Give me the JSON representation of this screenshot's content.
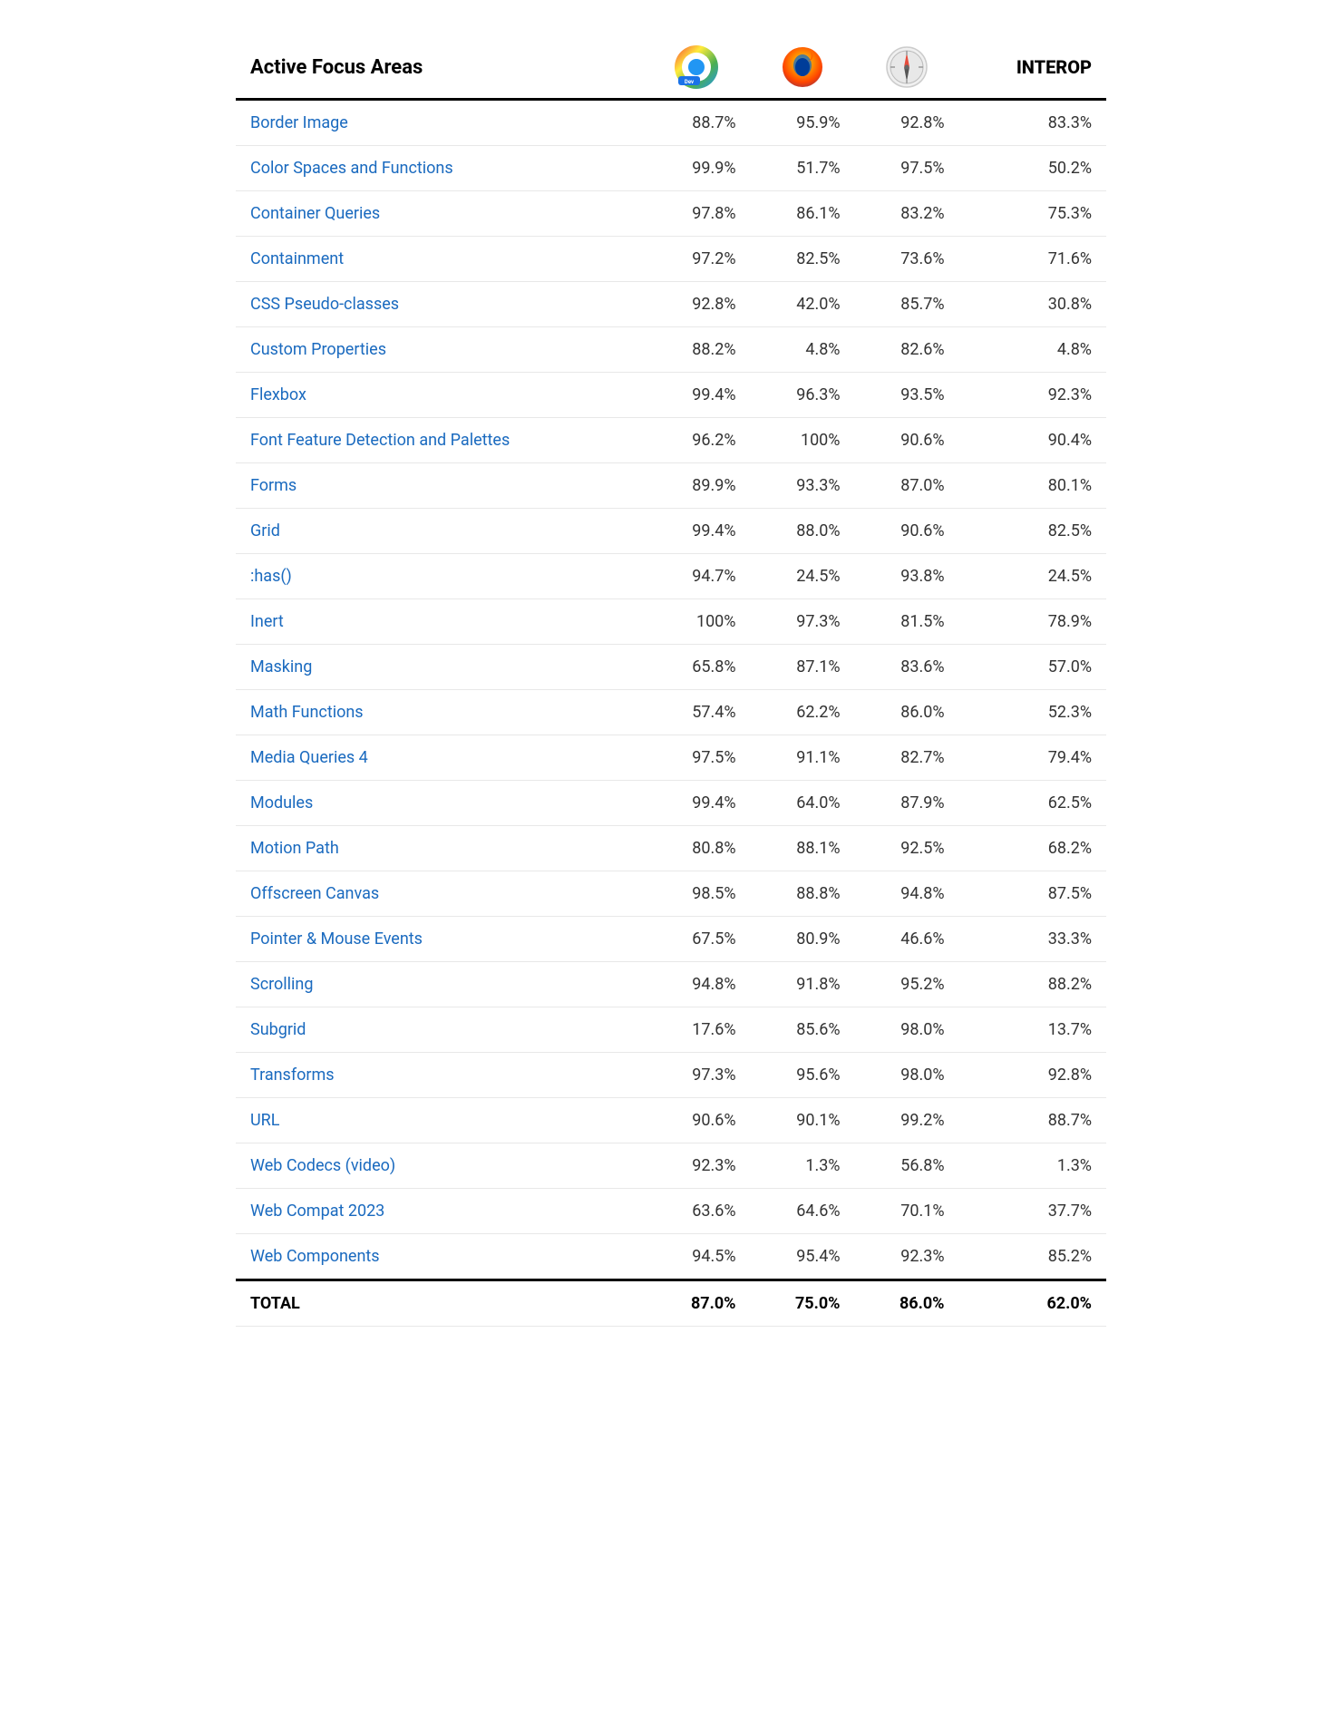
{
  "header": {
    "col1": "Active Focus Areas",
    "col4": "INTEROP",
    "icons": {
      "chrome": "Chrome Dev",
      "firefox": "Firefox",
      "safari": "Safari"
    }
  },
  "rows": [
    {
      "name": "Border Image",
      "chrome": "88.7%",
      "firefox": "95.9%",
      "safari": "92.8%",
      "interop": "83.3%"
    },
    {
      "name": "Color Spaces and Functions",
      "chrome": "99.9%",
      "firefox": "51.7%",
      "safari": "97.5%",
      "interop": "50.2%"
    },
    {
      "name": "Container Queries",
      "chrome": "97.8%",
      "firefox": "86.1%",
      "safari": "83.2%",
      "interop": "75.3%"
    },
    {
      "name": "Containment",
      "chrome": "97.2%",
      "firefox": "82.5%",
      "safari": "73.6%",
      "interop": "71.6%"
    },
    {
      "name": "CSS Pseudo-classes",
      "chrome": "92.8%",
      "firefox": "42.0%",
      "safari": "85.7%",
      "interop": "30.8%"
    },
    {
      "name": "Custom Properties",
      "chrome": "88.2%",
      "firefox": "4.8%",
      "safari": "82.6%",
      "interop": "4.8%"
    },
    {
      "name": "Flexbox",
      "chrome": "99.4%",
      "firefox": "96.3%",
      "safari": "93.5%",
      "interop": "92.3%"
    },
    {
      "name": "Font Feature Detection and Palettes",
      "chrome": "96.2%",
      "firefox": "100%",
      "safari": "90.6%",
      "interop": "90.4%"
    },
    {
      "name": "Forms",
      "chrome": "89.9%",
      "firefox": "93.3%",
      "safari": "87.0%",
      "interop": "80.1%"
    },
    {
      "name": "Grid",
      "chrome": "99.4%",
      "firefox": "88.0%",
      "safari": "90.6%",
      "interop": "82.5%"
    },
    {
      "name": ":has()",
      "chrome": "94.7%",
      "firefox": "24.5%",
      "safari": "93.8%",
      "interop": "24.5%"
    },
    {
      "name": "Inert",
      "chrome": "100%",
      "firefox": "97.3%",
      "safari": "81.5%",
      "interop": "78.9%"
    },
    {
      "name": "Masking",
      "chrome": "65.8%",
      "firefox": "87.1%",
      "safari": "83.6%",
      "interop": "57.0%"
    },
    {
      "name": "Math Functions",
      "chrome": "57.4%",
      "firefox": "62.2%",
      "safari": "86.0%",
      "interop": "52.3%"
    },
    {
      "name": "Media Queries 4",
      "chrome": "97.5%",
      "firefox": "91.1%",
      "safari": "82.7%",
      "interop": "79.4%"
    },
    {
      "name": "Modules",
      "chrome": "99.4%",
      "firefox": "64.0%",
      "safari": "87.9%",
      "interop": "62.5%"
    },
    {
      "name": "Motion Path",
      "chrome": "80.8%",
      "firefox": "88.1%",
      "safari": "92.5%",
      "interop": "68.2%"
    },
    {
      "name": "Offscreen Canvas",
      "chrome": "98.5%",
      "firefox": "88.8%",
      "safari": "94.8%",
      "interop": "87.5%"
    },
    {
      "name": "Pointer & Mouse Events",
      "chrome": "67.5%",
      "firefox": "80.9%",
      "safari": "46.6%",
      "interop": "33.3%"
    },
    {
      "name": "Scrolling",
      "chrome": "94.8%",
      "firefox": "91.8%",
      "safari": "95.2%",
      "interop": "88.2%"
    },
    {
      "name": "Subgrid",
      "chrome": "17.6%",
      "firefox": "85.6%",
      "safari": "98.0%",
      "interop": "13.7%"
    },
    {
      "name": "Transforms",
      "chrome": "97.3%",
      "firefox": "95.6%",
      "safari": "98.0%",
      "interop": "92.8%"
    },
    {
      "name": "URL",
      "chrome": "90.6%",
      "firefox": "90.1%",
      "safari": "99.2%",
      "interop": "88.7%"
    },
    {
      "name": "Web Codecs (video)",
      "chrome": "92.3%",
      "firefox": "1.3%",
      "safari": "56.8%",
      "interop": "1.3%"
    },
    {
      "name": "Web Compat 2023",
      "chrome": "63.6%",
      "firefox": "64.6%",
      "safari": "70.1%",
      "interop": "37.7%"
    },
    {
      "name": "Web Components",
      "chrome": "94.5%",
      "firefox": "95.4%",
      "safari": "92.3%",
      "interop": "85.2%"
    }
  ],
  "total": {
    "label": "TOTAL",
    "chrome": "87.0%",
    "firefox": "75.0%",
    "safari": "86.0%",
    "interop": "62.0%"
  }
}
